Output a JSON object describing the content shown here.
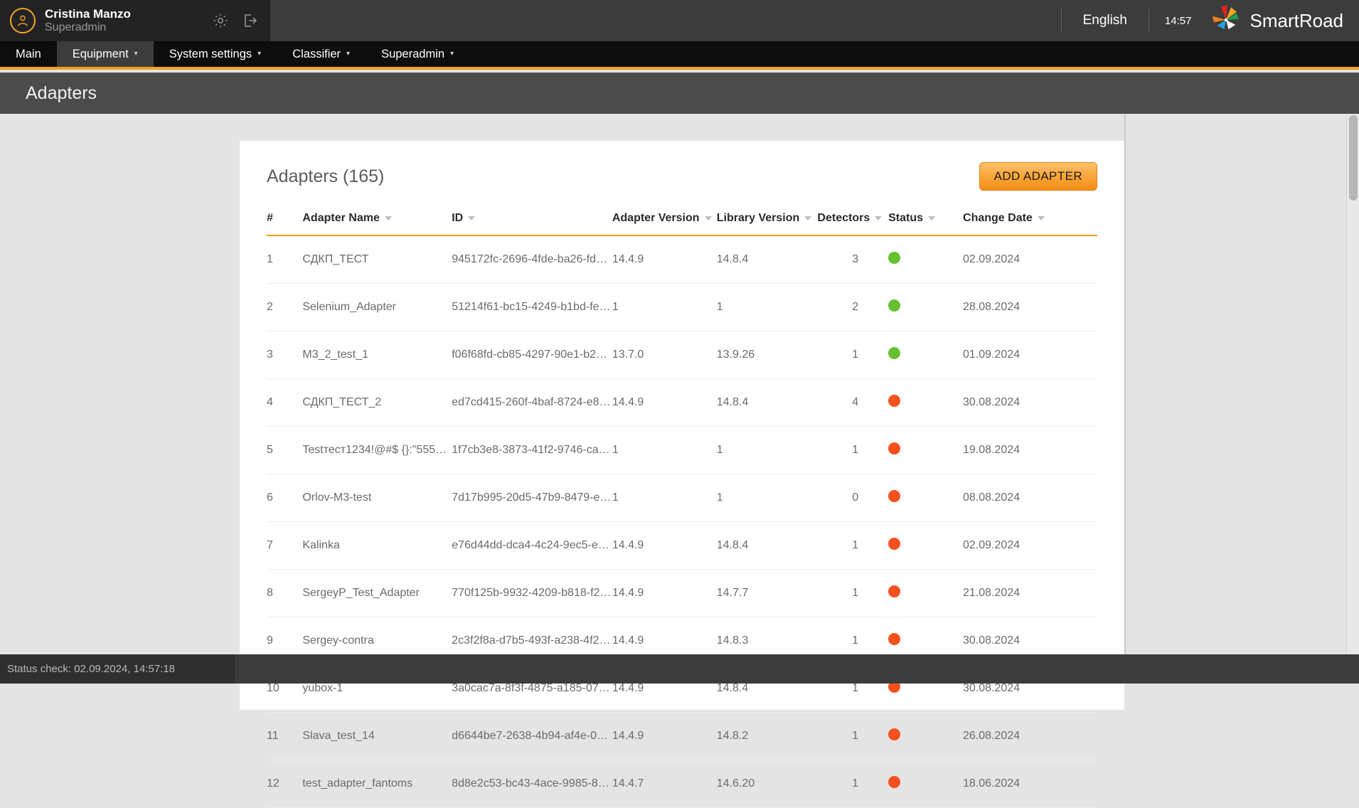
{
  "topbar": {
    "user_name": "Cristina Manzo",
    "user_role": "Superadmin",
    "settings_icon": "gear-icon",
    "logout_icon": "logout-icon",
    "language": "English",
    "time": "14:57",
    "brand": "SmartRoad",
    "logo_icon": "smartroad-pinwheel-logo"
  },
  "nav": {
    "items": [
      {
        "label": "Main",
        "has_caret": false,
        "active": false
      },
      {
        "label": "Equipment",
        "has_caret": true,
        "active": true
      },
      {
        "label": "System settings",
        "has_caret": true,
        "active": false
      },
      {
        "label": "Classifier",
        "has_caret": true,
        "active": false
      },
      {
        "label": "Superadmin",
        "has_caret": true,
        "active": false
      }
    ]
  },
  "page": {
    "title": "Adapters"
  },
  "card": {
    "title": "Adapters (165)",
    "add_button": "ADD ADAPTER"
  },
  "table": {
    "columns": [
      {
        "label": "#",
        "sortable": false
      },
      {
        "label": "Adapter Name",
        "sortable": true
      },
      {
        "label": "ID",
        "sortable": true
      },
      {
        "label": "Adapter Version",
        "sortable": true
      },
      {
        "label": "Library Version",
        "sortable": true
      },
      {
        "label": "Detectors",
        "sortable": true
      },
      {
        "label": "Status",
        "sortable": true
      },
      {
        "label": "Change Date",
        "sortable": true
      }
    ],
    "status_colors": {
      "ok": "#66c030",
      "error": "#f4511e"
    },
    "rows": [
      {
        "num": "1",
        "name": "СДКП_ТЕСТ",
        "id": "945172fc-2696-4fde-ba26-fd6…",
        "adapter_version": "14.4.9",
        "library_version": "14.8.4",
        "detectors": "3",
        "status": "ok",
        "change_date": "02.09.2024"
      },
      {
        "num": "2",
        "name": "Selenium_Adapter",
        "id": "51214f61-bc15-4249-b1bd-fe…",
        "adapter_version": "1",
        "library_version": "1",
        "detectors": "2",
        "status": "ok",
        "change_date": "28.08.2024"
      },
      {
        "num": "3",
        "name": "M3_2_test_1",
        "id": "f06f68fd-cb85-4297-90e1-b26…",
        "adapter_version": "13.7.0",
        "library_version": "13.9.26",
        "detectors": "1",
        "status": "ok",
        "change_date": "01.09.2024"
      },
      {
        "num": "4",
        "name": "СДКП_ТЕСТ_2",
        "id": "ed7cd415-260f-4baf-8724-e8…",
        "adapter_version": "14.4.9",
        "library_version": "14.8.4",
        "detectors": "4",
        "status": "error",
        "change_date": "30.08.2024"
      },
      {
        "num": "5",
        "name": "Testтест1234!@#$ {}:\"555555…",
        "id": "1f7cb3e8-3873-41f2-9746-ca…",
        "adapter_version": "1",
        "library_version": "1",
        "detectors": "1",
        "status": "error",
        "change_date": "19.08.2024"
      },
      {
        "num": "6",
        "name": "Orlov-M3-test",
        "id": "7d17b995-20d5-47b9-8479-e…",
        "adapter_version": "1",
        "library_version": "1",
        "detectors": "0",
        "status": "error",
        "change_date": "08.08.2024"
      },
      {
        "num": "7",
        "name": "Kalinka",
        "id": "e76d44dd-dca4-4c24-9ec5-e8…",
        "adapter_version": "14.4.9",
        "library_version": "14.8.4",
        "detectors": "1",
        "status": "error",
        "change_date": "02.09.2024"
      },
      {
        "num": "8",
        "name": "SergeyP_Test_Adapter",
        "id": "770f125b-9932-4209-b818-f2…",
        "adapter_version": "14.4.9",
        "library_version": "14.7.7",
        "detectors": "1",
        "status": "error",
        "change_date": "21.08.2024"
      },
      {
        "num": "9",
        "name": "Sergey-contra",
        "id": "2c3f2f8a-d7b5-493f-a238-4f2…",
        "adapter_version": "14.4.9",
        "library_version": "14.8.3",
        "detectors": "1",
        "status": "error",
        "change_date": "30.08.2024"
      },
      {
        "num": "10",
        "name": "yubox-1",
        "id": "3a0cac7a-8f3f-4875-a185-07…",
        "adapter_version": "14.4.9",
        "library_version": "14.8.4",
        "detectors": "1",
        "status": "error",
        "change_date": "30.08.2024"
      },
      {
        "num": "11",
        "name": "Slava_test_14",
        "id": "d6644be7-2638-4b94-af4e-0c…",
        "adapter_version": "14.4.9",
        "library_version": "14.8.2",
        "detectors": "1",
        "status": "error",
        "change_date": "26.08.2024"
      },
      {
        "num": "12",
        "name": "test_adapter_fantoms",
        "id": "8d8e2c53-bc43-4ace-9985-82…",
        "adapter_version": "14.4.7",
        "library_version": "14.6.20",
        "detectors": "1",
        "status": "error",
        "change_date": "18.06.2024"
      }
    ]
  },
  "statusbar": {
    "text": "Status check: 02.09.2024, 14:57:18"
  }
}
